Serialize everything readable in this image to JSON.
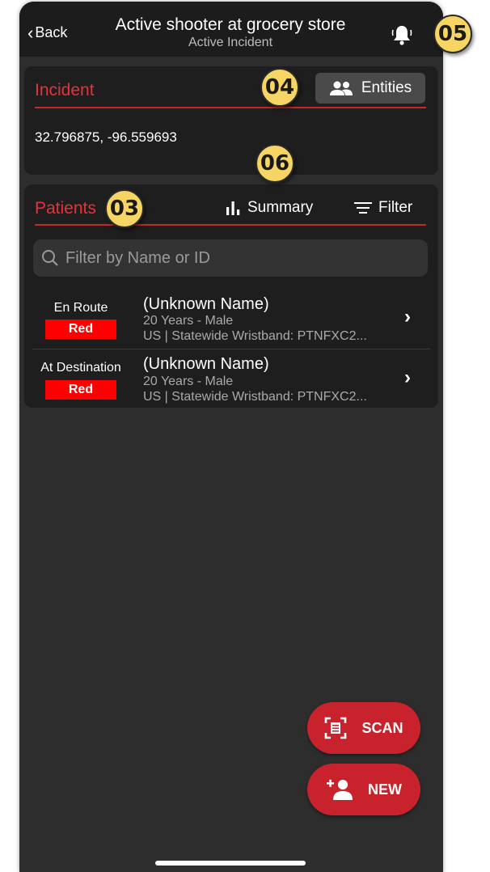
{
  "header": {
    "back_label": "Back",
    "title": "Active shooter at grocery store",
    "subtitle": "Active Incident"
  },
  "incident": {
    "section_title": "Incident",
    "entities_label": "Entities",
    "coordinates": "32.796875, -96.559693"
  },
  "patients": {
    "section_title": "Patients",
    "summary_label": "Summary",
    "filter_label": "Filter",
    "search_placeholder": "Filter by Name or ID",
    "rows": [
      {
        "status": "En Route",
        "triage": "Red",
        "name": "(Unknown Name)",
        "demographics": "20 Years - Male",
        "id_line": "US | Statewide Wristband: PTNFXC2..."
      },
      {
        "status": "At Destination",
        "triage": "Red",
        "name": "(Unknown Name)",
        "demographics": "20 Years - Male",
        "id_line": "US | Statewide Wristband: PTNFXC2..."
      }
    ]
  },
  "actions": {
    "scan_label": "SCAN",
    "new_label": "NEW"
  },
  "callouts": {
    "c03": "03",
    "c04": "04",
    "c05": "05",
    "c06": "06"
  },
  "colors": {
    "accent_red": "#e8323a",
    "triage_red": "#ff0000",
    "fab_red": "#c8222d",
    "callout_yellow": "#f7d565"
  }
}
